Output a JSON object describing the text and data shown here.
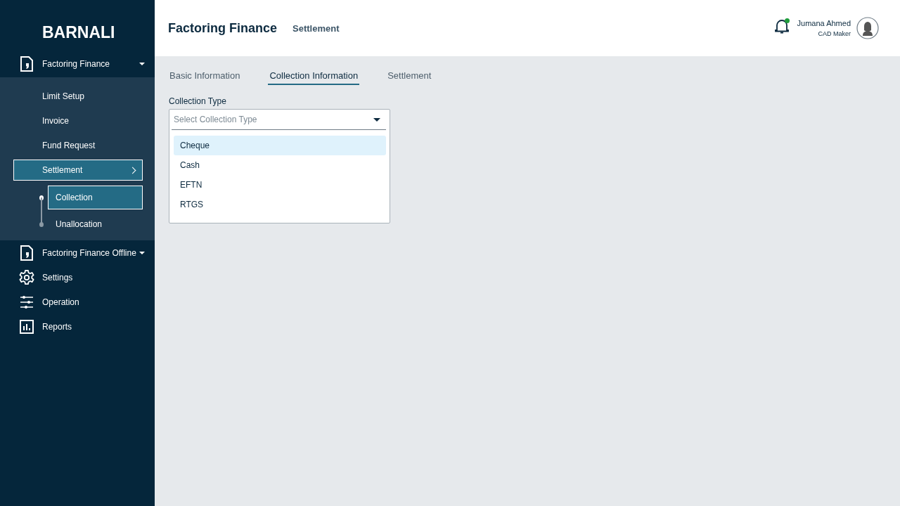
{
  "sidebar": {
    "brand": "BARNALI",
    "items": [
      {
        "label": "Factoring Finance",
        "kind": "document",
        "has_menu": true,
        "children": [
          {
            "label": "Limit Setup",
            "selected": false
          },
          {
            "label": "Invoice",
            "selected": false
          },
          {
            "label": "Fund Request",
            "selected": false
          },
          {
            "label": "Settlement",
            "selected": true,
            "children": [
              {
                "label": "Collection",
                "selected": true
              },
              {
                "label": "Unallocation",
                "selected": false
              }
            ]
          }
        ]
      },
      {
        "label": "Factoring Finance Offline",
        "kind": "document",
        "has_menu": true
      },
      {
        "label": "Settings",
        "kind": "gear",
        "has_menu": false
      },
      {
        "label": "Operation",
        "kind": "sliders",
        "has_menu": false
      },
      {
        "label": "Reports",
        "kind": "chart",
        "has_menu": false
      }
    ]
  },
  "header": {
    "title": "Factoring Finance",
    "breadcrumb": "Settlement",
    "user": {
      "name": "Jumana Ahmed",
      "role": "CAD Maker",
      "has_notification": true
    }
  },
  "tabs": [
    {
      "label": "Basic Information",
      "selected": false
    },
    {
      "label": "Collection Information",
      "selected": true
    },
    {
      "label": "Settlement",
      "selected": false
    }
  ],
  "collection_type": {
    "label": "Collection Type",
    "placeholder": "Select Collection Type",
    "options": [
      {
        "label": "Cheque",
        "selected": true
      },
      {
        "label": "Cash",
        "selected": false
      },
      {
        "label": "EFTN",
        "selected": false
      },
      {
        "label": "RTGS",
        "selected": false
      }
    ]
  }
}
